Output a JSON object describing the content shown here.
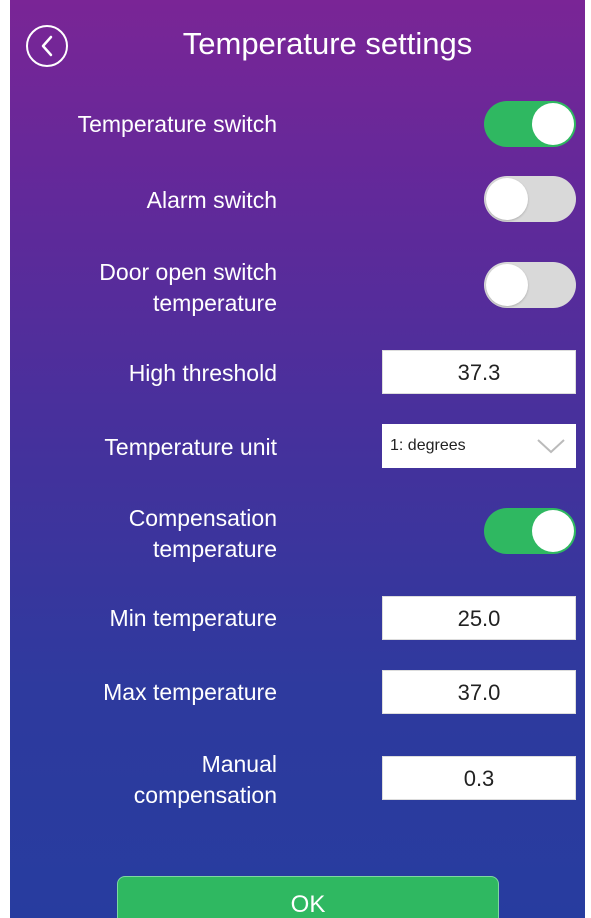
{
  "header": {
    "title": "Temperature settings",
    "back_icon": "chevron-left-icon"
  },
  "settings": {
    "temperature_switch": {
      "label": "Temperature switch",
      "on": true
    },
    "alarm_switch": {
      "label": "Alarm switch",
      "on": false
    },
    "door_open_switch": {
      "label_line1": "Door open switch",
      "label_line2": "temperature",
      "on": false
    },
    "high_threshold": {
      "label": "High threshold",
      "value": "37.3"
    },
    "temperature_unit": {
      "label": "Temperature unit",
      "selected": "1: degrees"
    },
    "compensation_temperature": {
      "label_line1": "Compensation",
      "label_line2": "temperature",
      "on": true
    },
    "min_temperature": {
      "label": "Min temperature",
      "value": "25.0"
    },
    "max_temperature": {
      "label": "Max temperature",
      "value": "37.0"
    },
    "manual_compensation": {
      "label_line1": "Manual",
      "label_line2": "compensation",
      "value": "0.3"
    }
  },
  "footer": {
    "ok_label": "OK"
  },
  "colors": {
    "toggle_on": "#2fb861",
    "toggle_off": "#d9d9d9",
    "gradient_top": "#7a2596",
    "gradient_bottom": "#273c9f"
  }
}
